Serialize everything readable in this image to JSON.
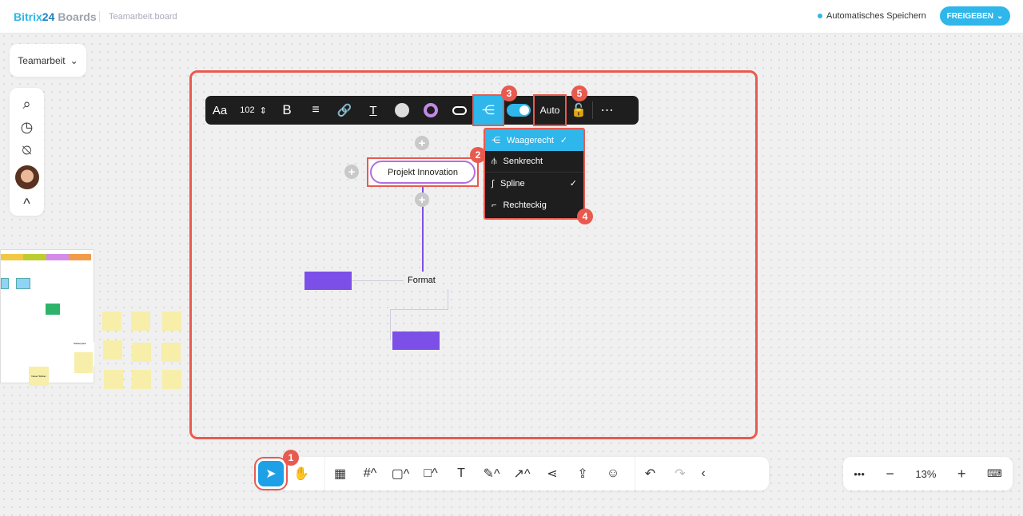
{
  "header": {
    "brand": "Bitrix",
    "brand_num": "24",
    "product": "Boards",
    "file": "Teamarbeit.board",
    "save_status": "Automatisches Speichern",
    "share": "FREIGEBEN"
  },
  "board_selector": "Teamarbeit",
  "toolbar": {
    "font": "Aa",
    "size": "102",
    "auto": "Auto"
  },
  "dropdown": [
    {
      "label": "Waagerecht",
      "checked": true
    },
    {
      "label": "Senkrecht",
      "checked": false
    },
    {
      "label": "Spline",
      "checked": true
    },
    {
      "label": "Rechteckig",
      "checked": false
    }
  ],
  "node": {
    "label": "Projekt Innovation"
  },
  "format_label": "Format",
  "badges": [
    "1",
    "2",
    "3",
    "4",
    "5"
  ],
  "zoom": "13%",
  "minimap": {
    "sticky": "Neuer Sticker",
    "label": "Stickerpack"
  },
  "colors": {
    "accent": "#2fb6ea",
    "highlight": "#e85a4f",
    "node": "#7c4fe8"
  }
}
